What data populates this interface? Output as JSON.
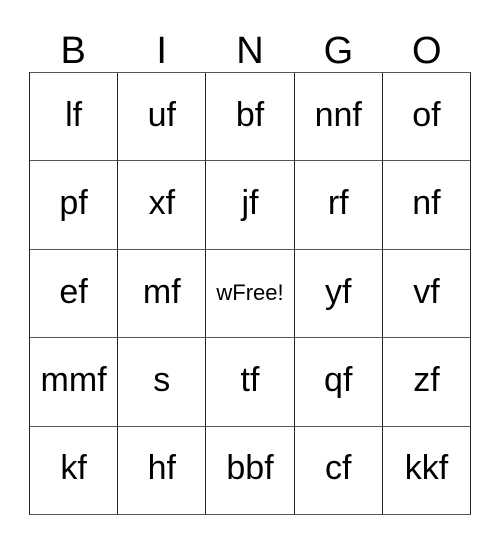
{
  "card": {
    "title_letters": [
      "B",
      "I",
      "N",
      "G",
      "O"
    ],
    "free_space_label": "wFree!",
    "text_color": "#000000",
    "background_color": "#ffffff",
    "grid_line_color": "#222222"
  },
  "grid": {
    "columns": 5,
    "rows": 5,
    "cells": [
      [
        "lf",
        "uf",
        "bf",
        "nnf",
        "of"
      ],
      [
        "pf",
        "xf",
        "jf",
        "rf",
        "nf"
      ],
      [
        "ef",
        "mf",
        "wFree!",
        "yf",
        "vf"
      ],
      [
        "mmf",
        "s",
        "tf",
        "qf",
        "zf"
      ],
      [
        "kf",
        "hf",
        "bbf",
        "cf",
        "kkf"
      ]
    ]
  }
}
